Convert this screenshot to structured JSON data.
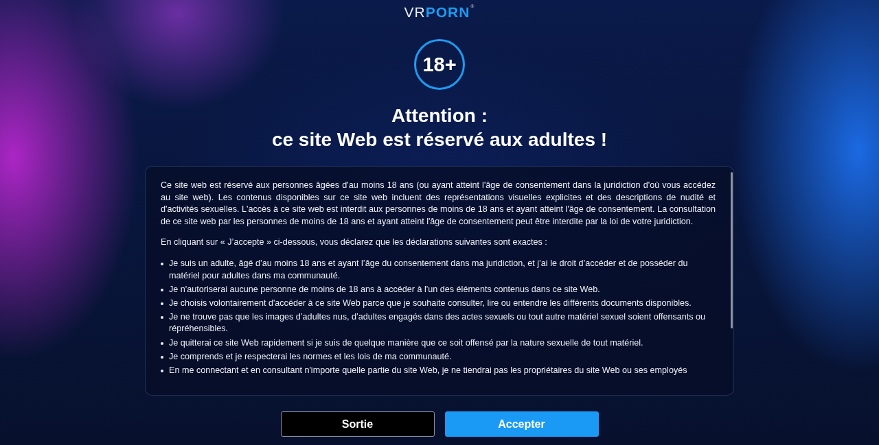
{
  "logo": {
    "light": "VR",
    "bold": "PORN",
    "mark": "®"
  },
  "badge": "18+",
  "heading": [
    "Attention :",
    "ce site Web est réservé aux adultes !"
  ],
  "intro": "Ce site web est réservé aux personnes âgées d'au moins 18 ans (ou ayant atteint l'âge de consentement dans la juridiction d'où vous accédez au site web). Les contenus disponibles sur ce site web incluent des représentations visuelles explicites et des descriptions de nudité et d'activités sexuelles. L'accès à ce site web est interdit aux personnes de moins de 18 ans et ayant atteint l'âge de consentement. La consultation de ce site web par les personnes de moins de 18 ans et ayant atteint l'âge de consentement peut être interdite par la loi de votre juridiction.",
  "lead": "En cliquant sur « J’accepte » ci-dessous, vous déclarez que les déclarations suivantes sont exactes :",
  "statements": [
    "Je suis un adulte, âgé d’au moins 18 ans et ayant l’âge du consentement dans ma juridiction, et j’ai le droit d’accéder et de posséder du matériel pour adultes dans ma communauté.",
    "Je n'autoriserai aucune personne de moins de 18 ans à accéder à l'un des éléments contenus dans ce site Web.",
    "Je choisis volontairement d'accéder à ce site Web parce que je souhaite consulter, lire ou entendre les différents documents disponibles.",
    "Je ne trouve pas que les images d’adultes nus, d’adultes engagés dans des actes sexuels ou tout autre matériel sexuel soient offensants ou répréhensibles.",
    "Je quitterai ce site Web rapidement si je suis de quelque manière que ce soit offensé par la nature sexuelle de tout matériel.",
    "Je comprends et je respecterai les normes et les lois de ma communauté.",
    "En me connectant et en consultant n'importe quelle partie du site Web, je ne tiendrai pas les propriétaires du site Web ou ses employés"
  ],
  "buttons": [
    {
      "label": "Sortie",
      "kind": "secondary"
    },
    {
      "label": "Accepter",
      "kind": "primary"
    }
  ]
}
